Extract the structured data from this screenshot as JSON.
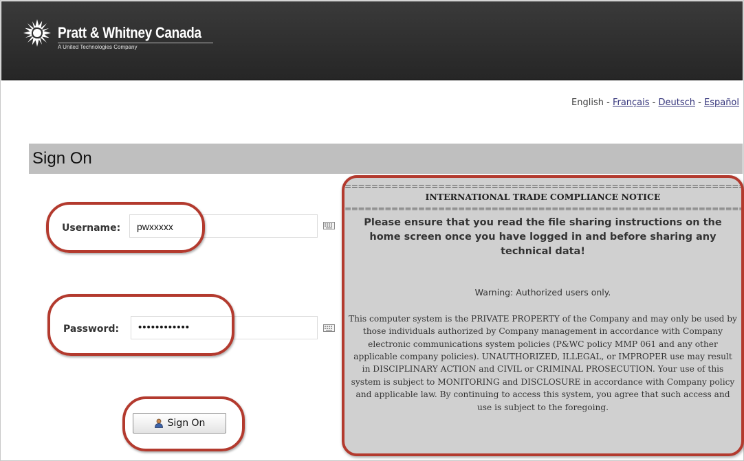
{
  "brand": {
    "name": "Pratt & Whitney Canada",
    "tagline": "A United Technologies Company"
  },
  "languages": {
    "current": "English",
    "separator": " - ",
    "links": [
      "Français",
      "Deutsch",
      "Español"
    ]
  },
  "page": {
    "title": "Sign On"
  },
  "form": {
    "username_label": "Username:",
    "username_value": "pwxxxxx",
    "password_label": "Password:",
    "password_value": "••••••••••••",
    "submit_label": "Sign On"
  },
  "notice": {
    "rule": "==============================================================================",
    "heading": "INTERNATIONAL TRADE COMPLIANCE NOTICE",
    "message": "Please ensure that you read the file sharing instructions on the home screen once you have logged in and before sharing any technical data!",
    "warning": "Warning: Authorized users only.",
    "body": "This computer system is the PRIVATE PROPERTY of the Company and may only be used by those individuals authorized by Company management in accordance with Company electronic communications system policies (P&WC policy MMP 061 and any other applicable company policies). UNAUTHORIZED, ILLEGAL, or IMPROPER use may result in DISCIPLINARY ACTION and CIVIL or CRIMINAL PROSECUTION. Your use of this system is subject to MONITORING and DISCLOSURE in accordance with Company policy and applicable law. By continuing to access this system, you agree that such access and use is subject to the foregoing."
  },
  "colors": {
    "header_bg": "#2e2e2e",
    "title_bar": "#bfbfbf",
    "highlight_ring": "#b33a2e",
    "notice_bg": "#d0d0d0",
    "link": "#33337a"
  },
  "icons": [
    "pratt-whitney-logo-icon",
    "keyboard-icon",
    "user-icon"
  ]
}
